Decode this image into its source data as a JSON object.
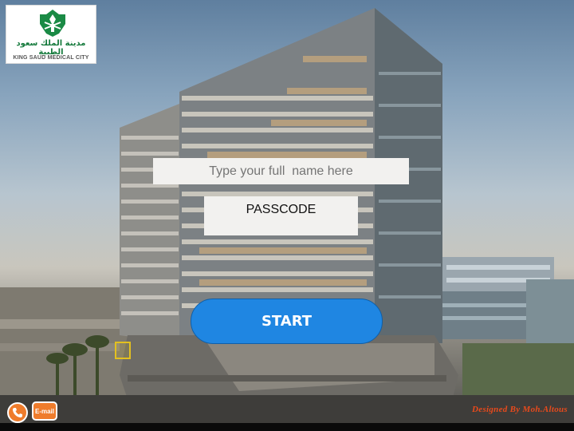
{
  "logo": {
    "arabic_text": "مدينة الملك سعود الطبية",
    "english_text": "KING SAUD MEDICAL CITY"
  },
  "form": {
    "name_placeholder": "Type your full  name here",
    "passcode_placeholder": "PASSCODE",
    "start_label": "START"
  },
  "footer": {
    "email_label": "E-mail",
    "credit": "Designed By Moh.Altous"
  },
  "colors": {
    "start_button": "#1f86e2",
    "contact_buttons": "#ef7c2c",
    "credit_text": "#e84a1c",
    "logo_green": "#157a3c"
  },
  "icons": [
    "phone-icon",
    "emblem-icon"
  ]
}
